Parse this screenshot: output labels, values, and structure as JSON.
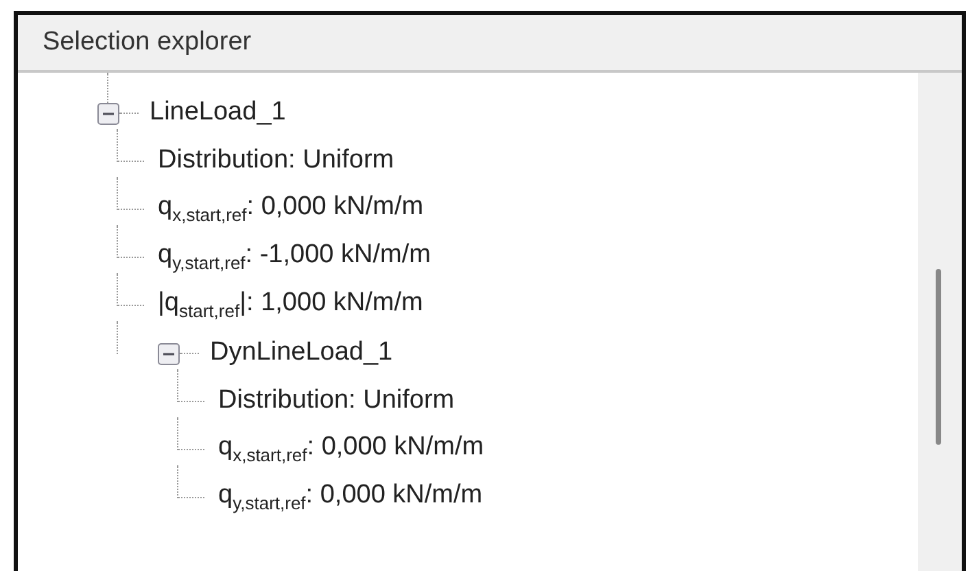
{
  "panel": {
    "title": "Selection explorer"
  },
  "tree": [
    {
      "label": "LineLoad_1",
      "expanded": true,
      "children": [
        {
          "label": "Distribution: Uniform"
        },
        {
          "label": "q$_{x,start,ref}$: 0,000 kN/m/m"
        },
        {
          "label": "q$_{y,start,ref}$: -1,000 kN/m/m"
        },
        {
          "label": "|q$_{start,ref}$|: 1,000 kN/m/m"
        },
        {
          "label": "DynLineLoad_1",
          "expanded": true,
          "children": [
            {
              "label": "Distribution: Uniform"
            },
            {
              "label": "q$_{x,start,ref}$: 0,000 kN/m/m"
            },
            {
              "label": "q$_{y,start,ref}$: 0,000 kN/m/m"
            }
          ]
        }
      ]
    }
  ]
}
